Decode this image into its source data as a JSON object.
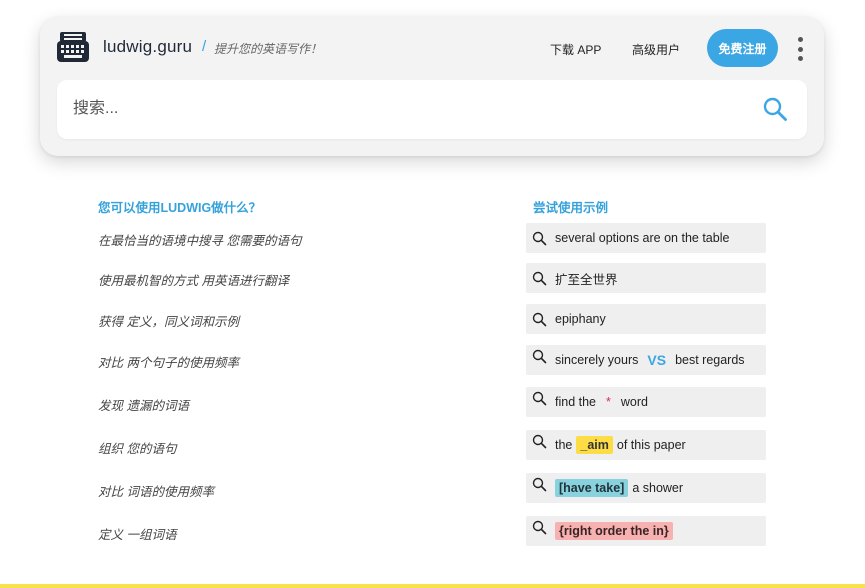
{
  "header": {
    "brand": "ludwig.guru",
    "slash": "/",
    "tagline": "提升您的英语写作！",
    "nav": {
      "app": "下载 APP",
      "pro": "高级用户"
    },
    "signup_label": "免费注册",
    "icons": {
      "logo": "typewriter-icon",
      "menu": "more-vertical-icon",
      "search": "search-icon"
    }
  },
  "search": {
    "placeholder": "搜索...",
    "value": ""
  },
  "features": {
    "heading": "您可以使用LUDWIG做什么？",
    "items": [
      "在最恰当的语境中搜寻 您需要的语句",
      "使用最机智的方式 用英语进行翻译",
      "获得 定义，同义词和示例",
      "对比 两个句子的使用频率",
      "发现 遗漏的词语",
      "组织 您的语句",
      "对比 词语的使用频率",
      "定义 一组词语"
    ]
  },
  "examples": {
    "heading": "尝试使用示例",
    "items": [
      {
        "text": "several options are on the table"
      },
      {
        "text": "扩至全世界"
      },
      {
        "text": "epiphany"
      },
      {
        "left": "sincerely yours",
        "vs": "VS",
        "right": "best regards"
      },
      {
        "before": "find the",
        "star": "*",
        "after": "word"
      },
      {
        "before": "the",
        "chip": "_aim",
        "after": "of this paper"
      },
      {
        "chip": "[have take]",
        "after": "a shower"
      },
      {
        "chip": "{right order the in}"
      }
    ]
  },
  "colors": {
    "accent": "#3ba6e4",
    "chip_yellow": "#fddd45",
    "chip_teal": "#88d2de",
    "chip_pink": "#f8b1b1",
    "star": "#e1266b",
    "bottom_bar": "#f8e24a"
  }
}
